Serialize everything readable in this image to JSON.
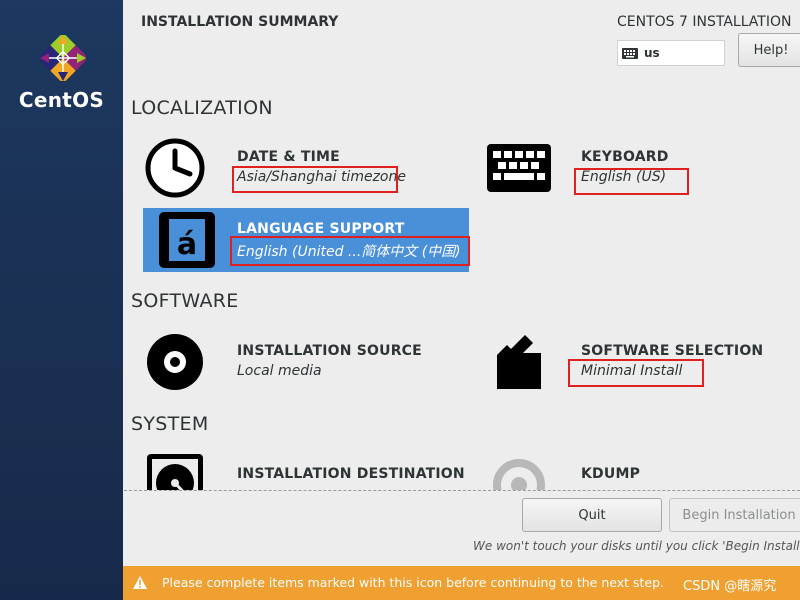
{
  "sidebar": {
    "brand": "CentOS"
  },
  "header": {
    "title": "INSTALLATION SUMMARY",
    "product": "CENTOS 7 INSTALLATION",
    "keyboard_layout": "us",
    "help_label": "Help!"
  },
  "sections": {
    "localization": "LOCALIZATION",
    "software": "SOFTWARE",
    "system": "SYSTEM"
  },
  "spokes": {
    "datetime": {
      "title": "DATE & TIME",
      "status": "Asia/Shanghai timezone",
      "icon": "clock-icon"
    },
    "keyboard": {
      "title": "KEYBOARD",
      "status": "English (US)",
      "icon": "keyboard-icon"
    },
    "language": {
      "title": "LANGUAGE SUPPORT",
      "status": "English (United ...简体中文 (中国)",
      "icon": "language-icon",
      "selected": true
    },
    "source": {
      "title": "INSTALLATION SOURCE",
      "status": "Local media",
      "icon": "disc-icon"
    },
    "software": {
      "title": "SOFTWARE SELECTION",
      "status": "Minimal Install",
      "icon": "package-icon"
    },
    "destination": {
      "title": "INSTALLATION DESTINATION",
      "icon": "harddisk-icon"
    },
    "kdump": {
      "title": "KDUMP",
      "icon": "kdump-icon"
    }
  },
  "footer": {
    "quit_label": "Quit",
    "begin_label": "Begin Installation",
    "note": "We won't touch your disks until you click 'Begin Installation'."
  },
  "warning": {
    "text": "Please complete items marked with this icon before continuing to the next step.",
    "watermark": "CSDN @瞎源究",
    "color": "#f0a030"
  },
  "colors": {
    "sidebar": "#1b3358",
    "selected": "#4a90d9",
    "highlight_box": "#e02020"
  }
}
